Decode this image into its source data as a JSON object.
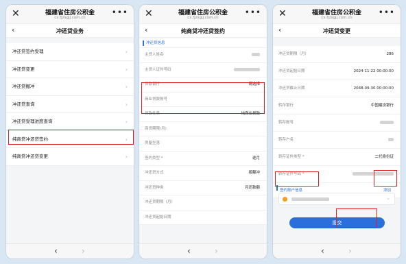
{
  "common": {
    "app_title": "福建省住房公积金",
    "app_subtitle": "cx.fjzsgjj.com.cn",
    "close_icon": "close-icon",
    "more_icon": "more-icon",
    "back_icon": "back-icon"
  },
  "screen1": {
    "page_title": "冲还贷业务",
    "menu": [
      {
        "label": "冲还贷签约受理"
      },
      {
        "label": "冲还贷变更"
      },
      {
        "label": "冲还贷撤冲"
      },
      {
        "label": "冲还贷查询"
      },
      {
        "label": "冲还贷受理进度查询"
      },
      {
        "label": "纯商贷冲还贷签约"
      },
      {
        "label": "纯商贷冲还贷变更"
      }
    ]
  },
  "screen2": {
    "page_title": "纯商贷冲还贷签约",
    "section_title": "冲还贷信息",
    "fields": [
      {
        "label": "主贷人姓名",
        "value": ""
      },
      {
        "label": "主贷人证件号码",
        "value": ""
      },
      {
        "label": "贷款银行",
        "value": "请选择"
      },
      {
        "label": "商业贷款账号",
        "value": ""
      },
      {
        "label": "贷款性质",
        "value": "纯商业贷款"
      },
      {
        "label": "商贷期限(月)",
        "value": ""
      },
      {
        "label": "房屋坐落",
        "value": ""
      },
      {
        "label": "签约类型 *",
        "value": "逐月"
      },
      {
        "label": "冲还贷方式",
        "value": "按额冲"
      },
      {
        "label": "冲还贷种类",
        "value": "月还款额"
      },
      {
        "label": "冲还贷期限（月）",
        "value": ""
      },
      {
        "label": "冲还贷起始日期",
        "value": ""
      }
    ]
  },
  "screen3": {
    "page_title": "冲还贷变更",
    "fields": [
      {
        "label": "冲还贷期限（月）",
        "value": "286"
      },
      {
        "label": "冲还贷起始日期",
        "value": "2024-11-22 00:00:00"
      },
      {
        "label": "冲还贷截止日期",
        "value": "2048-09-30 00:00:00"
      },
      {
        "label": "转存银行",
        "value": "中国建设银行"
      },
      {
        "label": "转存账号",
        "value": ""
      },
      {
        "label": "转存户名",
        "value": ""
      },
      {
        "label": "转存证件类型 *",
        "value": "二代身份证"
      },
      {
        "label": "转存证件号码 *",
        "value": ""
      }
    ],
    "section_title": "签约账户信息",
    "add_label": "添加",
    "submit_label": "提交"
  },
  "colors": {
    "accent": "#2a6fdb",
    "highlight": "#e02020",
    "background": "#d9e6f3"
  }
}
